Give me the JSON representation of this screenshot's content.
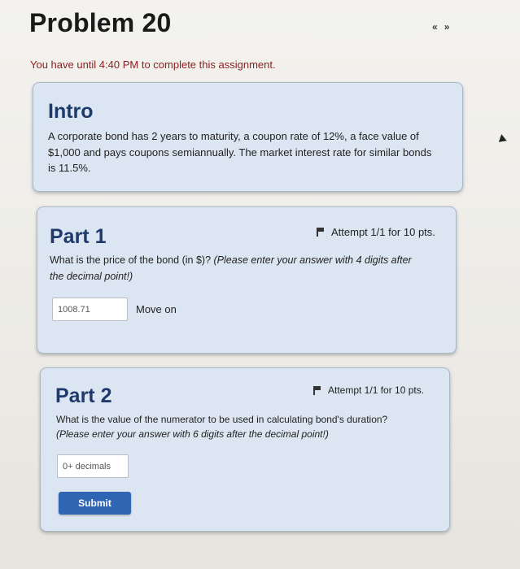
{
  "header": {
    "title": "Problem 20",
    "nav_prev": "«",
    "nav_next": "»",
    "deadline": "You have until 4:40 PM to complete this assignment."
  },
  "intro": {
    "heading": "Intro",
    "text_line1": "A corporate bond has 2 years to maturity, a coupon rate of 12%, a face value of",
    "text_line2": "$1,000 and pays coupons semiannually. The market interest rate for similar bonds",
    "text_line3": "is 11.5%."
  },
  "part1": {
    "heading": "Part 1",
    "attempt": "Attempt 1/1 for 10 pts.",
    "question_line1": "What is the price of the bond (in $)?",
    "question_line1_italic": "(Please enter your answer with 4 digits after",
    "question_line2_italic": "the decimal point!)",
    "answer_value": "1008.71",
    "move_on": "Move on"
  },
  "part2": {
    "heading": "Part 2",
    "attempt": "Attempt 1/1 for 10 pts.",
    "question_line1": "What is the value of the numerator to be used in calculating bond's duration?",
    "question_line2_italic": "(Please enter your answer with 6 digits after the decimal point!)",
    "answer_placeholder": "0+ decimals",
    "submit_label": "Submit"
  }
}
